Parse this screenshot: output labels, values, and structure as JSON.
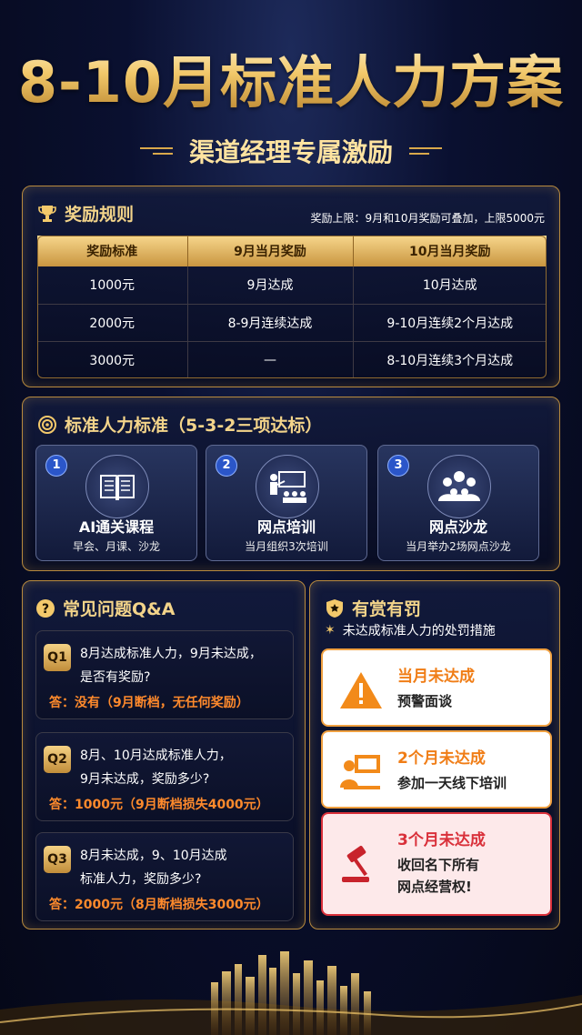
{
  "header": {
    "title": "8-10月标准人力方案",
    "subtitle": "渠道经理专属激励"
  },
  "rewards": {
    "title": "奖励规则",
    "limit_note": "奖励上限：9月和10月奖励可叠加，上限5000元",
    "columns": [
      "奖励标准",
      "9月当月奖励",
      "10月当月奖励"
    ],
    "rows": [
      [
        "1000元",
        "9月达成",
        "10月达成"
      ],
      [
        "2000元",
        "8-9月连续达成",
        "9-10月连续2个月达成"
      ],
      [
        "3000元",
        "—",
        "8-10月连续3个月达成"
      ]
    ]
  },
  "standard": {
    "title": "标准人力标准（5-3-2三项达标）",
    "items": [
      {
        "num": "1",
        "title": "AI通关课程",
        "desc": "早会、月课、沙龙",
        "icon": "book-icon"
      },
      {
        "num": "2",
        "title": "网点培训",
        "desc": "当月组织3次培训",
        "icon": "training-icon"
      },
      {
        "num": "3",
        "title": "网点沙龙",
        "desc": "当月举办2场网点沙龙",
        "icon": "group-icon"
      }
    ]
  },
  "qa": {
    "title": "常见问题Q&A",
    "items": [
      {
        "q": "Q1",
        "question_lines": [
          "8月达成标准人力，9月未达成，",
          "是否有奖励?"
        ],
        "answer": "答：没有（9月断档，无任何奖励）"
      },
      {
        "q": "Q2",
        "question_lines": [
          "8月、10月达成标准人力，",
          "9月未达成，奖励多少?"
        ],
        "answer": "答：1000元（9月断档损失4000元）"
      },
      {
        "q": "Q3",
        "question_lines": [
          "8月未达成，9、10月达成",
          "标准人力，奖励多少?"
        ],
        "answer": "答：2000元（8月断档损失3000元）"
      }
    ]
  },
  "penalty": {
    "title": "有赏有罚",
    "subtitle": "未达成标准人力的处罚措施",
    "items": [
      {
        "title": "当月未达成",
        "lines": [
          "预警面谈"
        ],
        "icon": "warning-icon"
      },
      {
        "title": "2个月未达成",
        "lines": [
          "参加一天线下培训"
        ],
        "icon": "offline-training-icon"
      },
      {
        "title": "3个月未达成",
        "lines": [
          "收回名下所有",
          "网点经营权!"
        ],
        "icon": "gavel-icon"
      }
    ]
  },
  "colors": {
    "gold": "#d9a84b",
    "orange": "#f07d16",
    "red": "#d9303a",
    "navy": "#0a1030"
  }
}
